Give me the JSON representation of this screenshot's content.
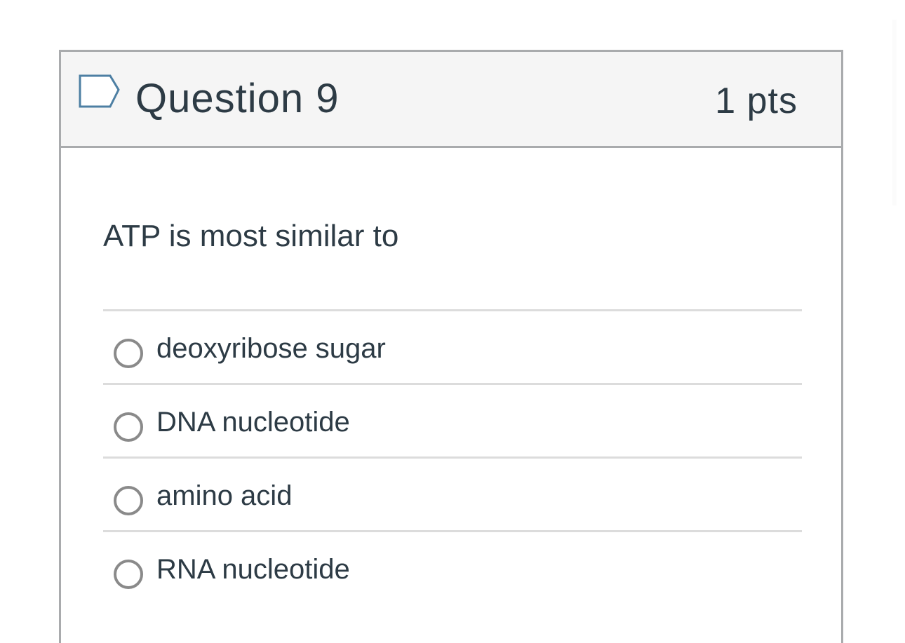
{
  "question": {
    "title": "Question 9",
    "points": "1 pts",
    "flag_icon": "bookmark-flag-icon",
    "text": "ATP is most similar to",
    "answers": [
      {
        "label": "deoxyribose sugar",
        "selected": false
      },
      {
        "label": "DNA nucleotide",
        "selected": false
      },
      {
        "label": "amino acid",
        "selected": false
      },
      {
        "label": "RNA nucleotide",
        "selected": false
      }
    ]
  },
  "colors": {
    "text": "#2d3b45",
    "header_background": "#f5f5f5",
    "border": "#a9abad",
    "divider": "#dcdcdc",
    "radio_border": "#8a8a8a",
    "flag_outline": "#4d7fa3"
  }
}
